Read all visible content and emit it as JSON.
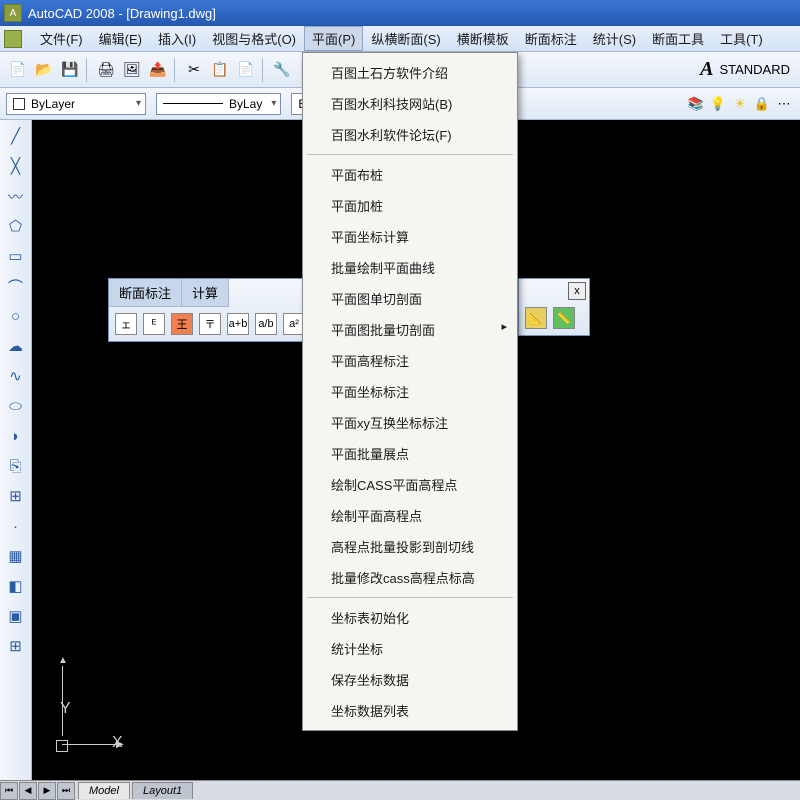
{
  "title": "AutoCAD 2008 - [Drawing1.dwg]",
  "menubar": [
    "文件(F)",
    "编辑(E)",
    "插入(I)",
    "视图与格式(O)",
    "平面(P)",
    "纵横断面(S)",
    "横断模板",
    "断面标注",
    "统计(S)",
    "断面工具",
    "工具(T)"
  ],
  "active_menu_index": 4,
  "style_name": "STANDARD",
  "layer_combo": "ByLayer",
  "linetype_combo": "ByLay",
  "color_combo": "ByColor",
  "floating1": {
    "tabs": [
      "断面标注",
      "计算"
    ]
  },
  "floating2": {
    "close": "x"
  },
  "dropdown": {
    "group1": [
      "百图土石方软件介绍",
      "百图水利科技网站(B)",
      "百图水利软件论坛(F)"
    ],
    "group2": [
      "平面布桩",
      "平面加桩",
      "平面坐标计算",
      "批量绘制平面曲线",
      "平面图单切剖面",
      {
        "label": "平面图批量切剖面",
        "sub": true
      },
      "平面高程标注",
      "平面坐标标注",
      "平面xy互换坐标标注",
      "平面批量展点",
      "绘制CASS平面高程点",
      "绘制平面高程点",
      "高程点批量投影到剖切线",
      "批量修改cass高程点标高"
    ],
    "group3": [
      "坐标表初始化",
      "统计坐标",
      "保存坐标数据",
      "坐标数据列表"
    ]
  },
  "ucs": {
    "x": "X",
    "y": "Y"
  },
  "tabs": {
    "model": "Model",
    "layout1": "Layout1"
  },
  "nav": [
    "⏮",
    "◀",
    "▶",
    "⏭"
  ]
}
